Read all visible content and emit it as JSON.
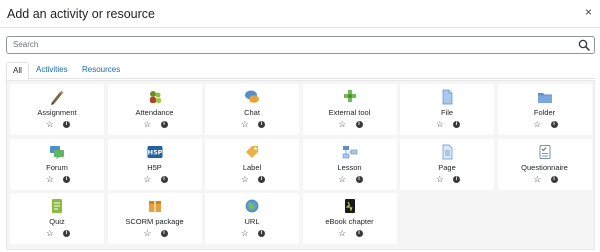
{
  "modal": {
    "title": "Add an activity or resource",
    "close_glyph": "×"
  },
  "search": {
    "placeholder": "Search",
    "icon": "search-icon"
  },
  "tabs": [
    {
      "label": "All",
      "active": true
    },
    {
      "label": "Activities",
      "active": false
    },
    {
      "label": "Resources",
      "active": false
    }
  ],
  "items": [
    {
      "label": "Assignment",
      "icon": "assignment-icon"
    },
    {
      "label": "Attendance",
      "icon": "attendance-icon"
    },
    {
      "label": "Chat",
      "icon": "chat-icon"
    },
    {
      "label": "External tool",
      "icon": "external-tool-icon"
    },
    {
      "label": "File",
      "icon": "file-icon"
    },
    {
      "label": "Folder",
      "icon": "folder-icon"
    },
    {
      "label": "Forum",
      "icon": "forum-icon"
    },
    {
      "label": "H5P",
      "icon": "h5p-icon"
    },
    {
      "label": "Label",
      "icon": "label-icon"
    },
    {
      "label": "Lesson",
      "icon": "lesson-icon"
    },
    {
      "label": "Page",
      "icon": "page-icon"
    },
    {
      "label": "Questionnaire",
      "icon": "questionnaire-icon"
    },
    {
      "label": "Quiz",
      "icon": "quiz-icon"
    },
    {
      "label": "SCORM package",
      "icon": "scorm-package-icon"
    },
    {
      "label": "URL",
      "icon": "url-icon"
    },
    {
      "label": "eBook chapter",
      "icon": "ebook-chapter-icon"
    }
  ],
  "item_actions": {
    "star_glyph": "☆",
    "info_glyph": "i"
  }
}
